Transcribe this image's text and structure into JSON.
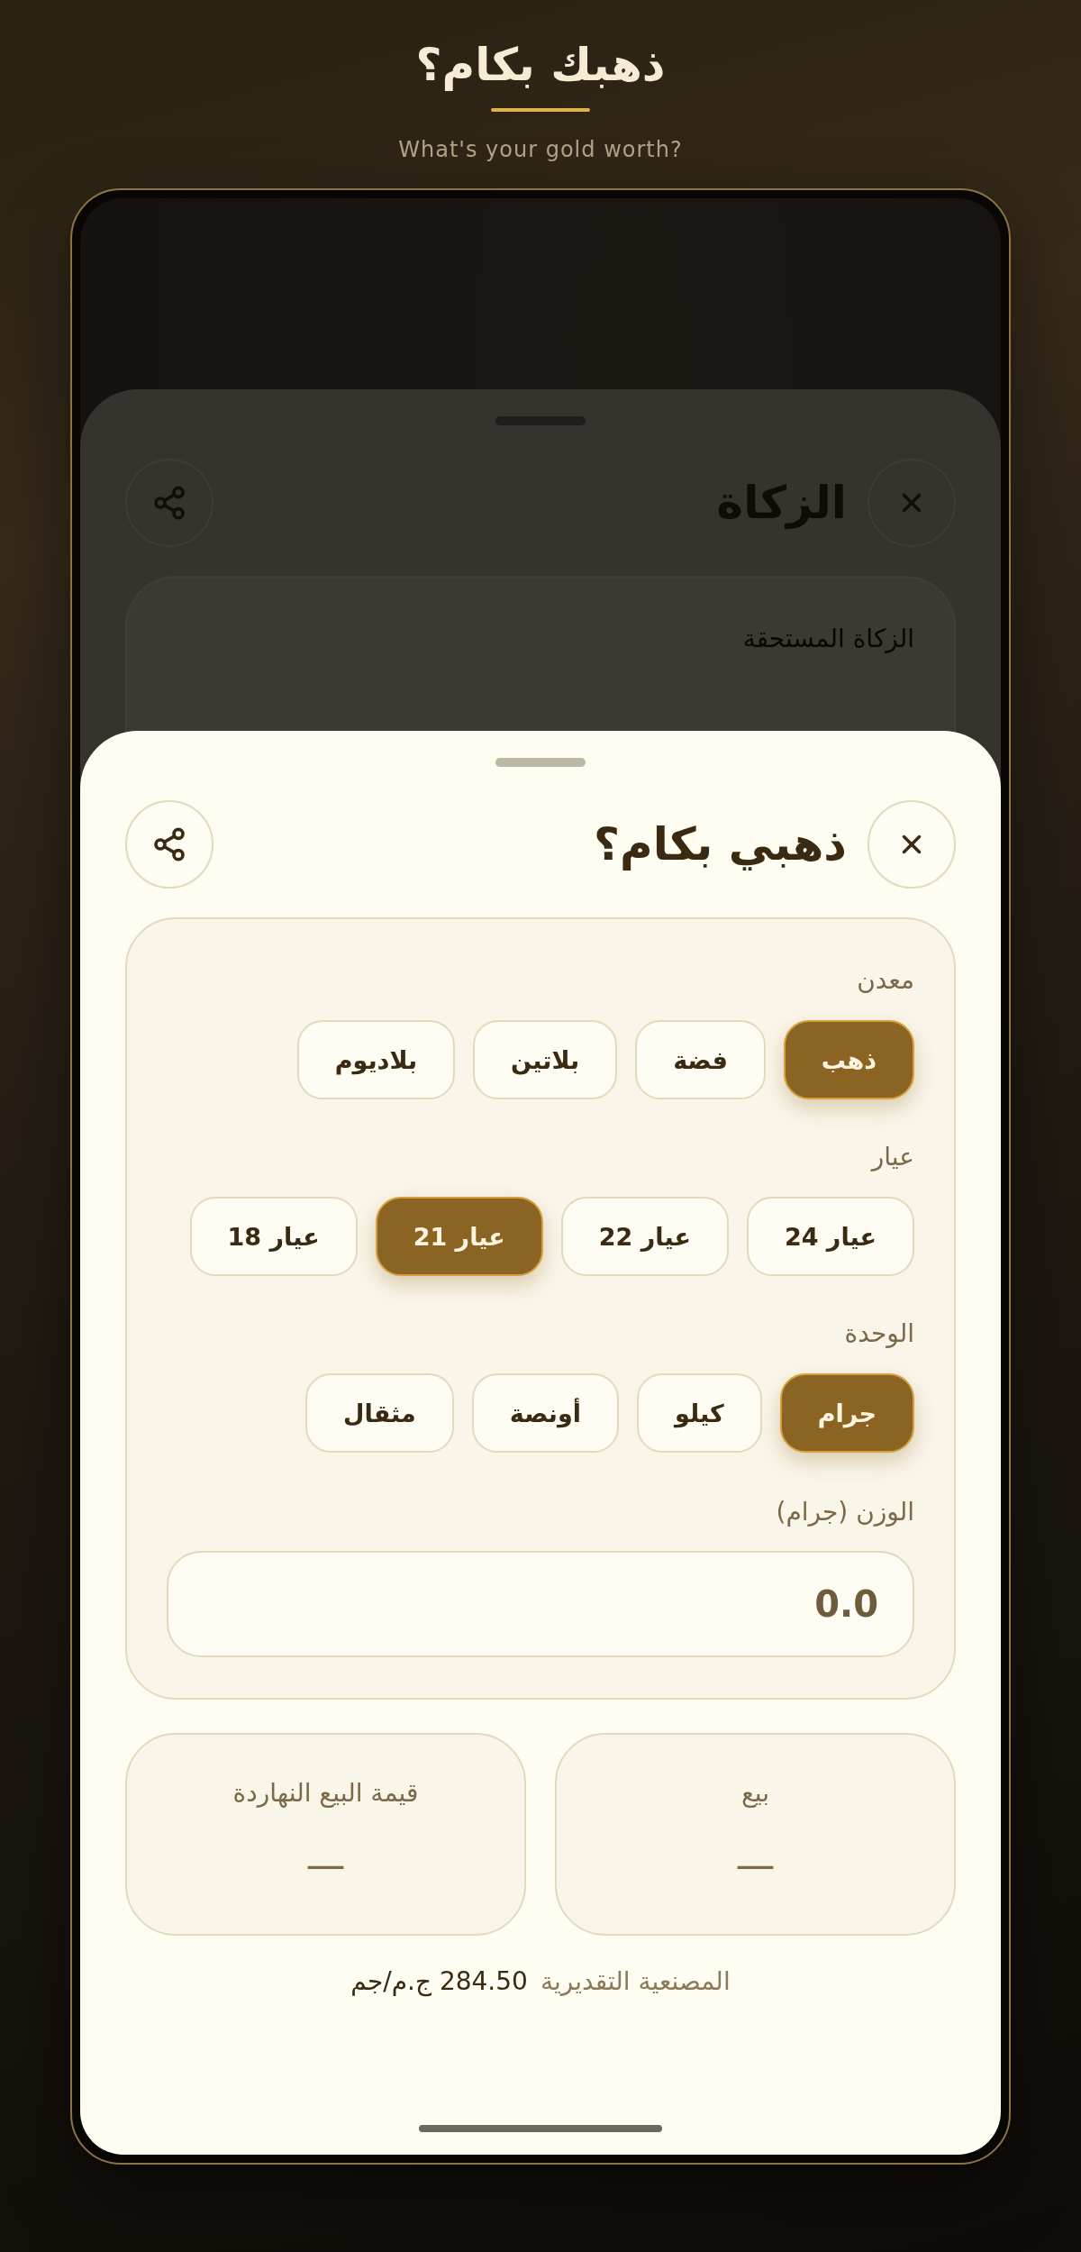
{
  "header": {
    "title": "ذهبك بكام؟",
    "subtitle": "What's your gold worth?"
  },
  "background_sheet": {
    "title": "الزكاة",
    "card_label": "الزكاة المستحقة"
  },
  "sheet": {
    "title": "ذهبي بكام؟",
    "groups": [
      {
        "label": "معدن",
        "options": [
          {
            "label": "ذهب",
            "selected": true
          },
          {
            "label": "فضة",
            "selected": false
          },
          {
            "label": "بلاتين",
            "selected": false
          },
          {
            "label": "بلاديوم",
            "selected": false
          }
        ]
      },
      {
        "label": "عيار",
        "options": [
          {
            "label": "عيار 24",
            "selected": false
          },
          {
            "label": "عيار 22",
            "selected": false
          },
          {
            "label": "عيار 21",
            "selected": true
          },
          {
            "label": "عيار 18",
            "selected": false
          }
        ]
      },
      {
        "label": "الوحدة",
        "options": [
          {
            "label": "جرام",
            "selected": true
          },
          {
            "label": "كيلو",
            "selected": false
          },
          {
            "label": "أونصة",
            "selected": false
          },
          {
            "label": "مثقال",
            "selected": false
          }
        ]
      }
    ],
    "weight": {
      "label": "الوزن (جرام)",
      "placeholder": "0.0"
    },
    "results": [
      {
        "label": "بيع",
        "value": "—"
      },
      {
        "label": "قيمة البيع النهاردة",
        "value": "—"
      }
    ],
    "workmanship": {
      "label": "المصنعية التقديرية",
      "value": "284.50 ج.م/جم"
    }
  }
}
